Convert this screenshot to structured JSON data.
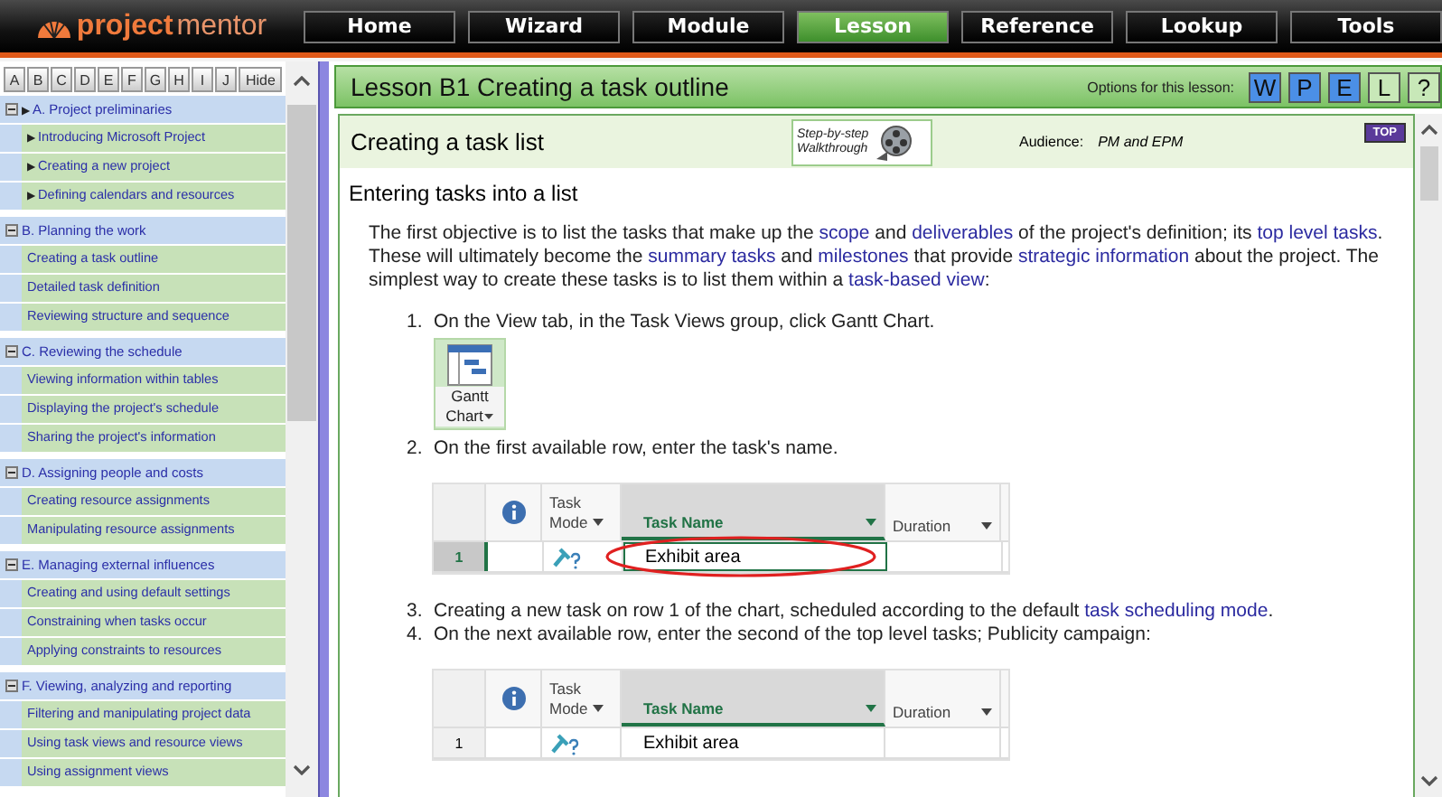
{
  "logo": {
    "first": "project",
    "second": "mentor"
  },
  "nav": [
    {
      "label": "Home",
      "selected": false
    },
    {
      "label": "Wizard",
      "selected": false
    },
    {
      "label": "Module",
      "selected": false
    },
    {
      "label": "Lesson",
      "selected": true
    },
    {
      "label": "Reference",
      "selected": false
    },
    {
      "label": "Lookup",
      "selected": false
    },
    {
      "label": "Tools",
      "selected": false
    }
  ],
  "letters": [
    "A",
    "B",
    "C",
    "D",
    "E",
    "F",
    "G",
    "H",
    "I",
    "J"
  ],
  "hide_button": "Hide",
  "sidebar": {
    "sections": [
      {
        "title": "A. Project preliminaries",
        "bullet": "▶",
        "expanded": true,
        "items": [
          {
            "label": "Introducing Microsoft Project",
            "bullet": "▶"
          },
          {
            "label": "Creating a new project",
            "bullet": "▶"
          },
          {
            "label": "Defining calendars and resources",
            "bullet": "▶"
          }
        ]
      },
      {
        "title": "B. Planning the work",
        "expanded": true,
        "items": [
          {
            "label": "Creating a task outline"
          },
          {
            "label": "Detailed task definition"
          },
          {
            "label": "Reviewing structure and sequence"
          }
        ]
      },
      {
        "title": "C. Reviewing the schedule",
        "expanded": true,
        "items": [
          {
            "label": "Viewing information within tables"
          },
          {
            "label": "Displaying the project's schedule"
          },
          {
            "label": "Sharing the project's information"
          }
        ]
      },
      {
        "title": "D. Assigning people and costs",
        "expanded": true,
        "items": [
          {
            "label": "Creating resource assignments"
          },
          {
            "label": "Manipulating resource assignments"
          }
        ]
      },
      {
        "title": "E. Managing external influences",
        "expanded": true,
        "items": [
          {
            "label": "Creating and using default settings"
          },
          {
            "label": "Constraining when tasks occur"
          },
          {
            "label": "Applying constraints to resources"
          }
        ]
      },
      {
        "title": "F. Viewing, analyzing and reporting",
        "expanded": true,
        "items": [
          {
            "label": "Filtering and manipulating project data"
          },
          {
            "label": "Using task views and resource views"
          },
          {
            "label": "Using assignment views"
          }
        ]
      }
    ]
  },
  "lesson": {
    "title": "Lesson B1 Creating a task outline",
    "options_label": "Options for this lesson:",
    "options": [
      {
        "label": "W",
        "on": true
      },
      {
        "label": "P",
        "on": true
      },
      {
        "label": "E",
        "on": true
      },
      {
        "label": "L",
        "on": false
      },
      {
        "label": "?",
        "on": false
      }
    ]
  },
  "section": {
    "title": "Creating a task list",
    "walkthrough": [
      "Step-by-step",
      "Walkthrough"
    ],
    "audience_label": "Audience:",
    "audience": "PM and EPM",
    "top_badge": "TOP"
  },
  "heading": "Entering tasks into a list",
  "intro": [
    {
      "t": "The first objective is to list the tasks that make up the ",
      "link": false
    },
    {
      "t": "scope",
      "link": true
    },
    {
      "t": " and ",
      "link": false
    },
    {
      "t": "deliverables",
      "link": true
    },
    {
      "t": " of the project's definition; its ",
      "link": false
    },
    {
      "t": "top level tasks",
      "link": true
    },
    {
      "t": ".  These will ultimately become the ",
      "link": false
    },
    {
      "t": "summary tasks",
      "link": true
    },
    {
      "t": " and ",
      "link": false
    },
    {
      "t": "milestones",
      "link": true
    },
    {
      "t": " that provide ",
      "link": false
    },
    {
      "t": "strategic information",
      "link": true
    },
    {
      "t": " about the project.  The simplest way to create these tasks is to list them within a ",
      "link": false
    },
    {
      "t": "task-based view",
      "link": true
    },
    {
      "t": ":",
      "link": false
    }
  ],
  "steps": [
    {
      "number": "1.",
      "text": [
        {
          "t": "On the View tab, in the Task Views group, click Gantt Chart.",
          "link": false
        }
      ],
      "figure": {
        "kind": "gantt-button",
        "lines": [
          "Gantt",
          "Chart"
        ]
      }
    },
    {
      "number": "2.",
      "text": [
        {
          "t": "On the first available row, enter the task's name.",
          "link": false
        }
      ],
      "figure": {
        "kind": "task-table",
        "columns": {
          "mode": [
            "Task",
            "Mode"
          ],
          "name": "Task Name",
          "duration": "Duration"
        },
        "rows": [
          {
            "number": "1",
            "name": "Exhibit area",
            "circled": true,
            "selected": true
          }
        ]
      }
    },
    {
      "number": "3.",
      "text": [
        {
          "t": "Creating a new task on row 1 of the chart, scheduled according to the default ",
          "link": false
        },
        {
          "t": "task scheduling mode",
          "link": true
        },
        {
          "t": ".",
          "link": false
        }
      ]
    },
    {
      "number": "4.",
      "text": [
        {
          "t": "On the next available row, enter the second of the top level tasks; Publicity campaign:",
          "link": false
        }
      ],
      "figure": {
        "kind": "task-table",
        "columns": {
          "mode": [
            "Task",
            "Mode"
          ],
          "name": "Task Name",
          "duration": "Duration"
        },
        "rows": [
          {
            "number": "1",
            "name": "Exhibit area",
            "circled": false,
            "selected": false
          }
        ]
      }
    }
  ]
}
